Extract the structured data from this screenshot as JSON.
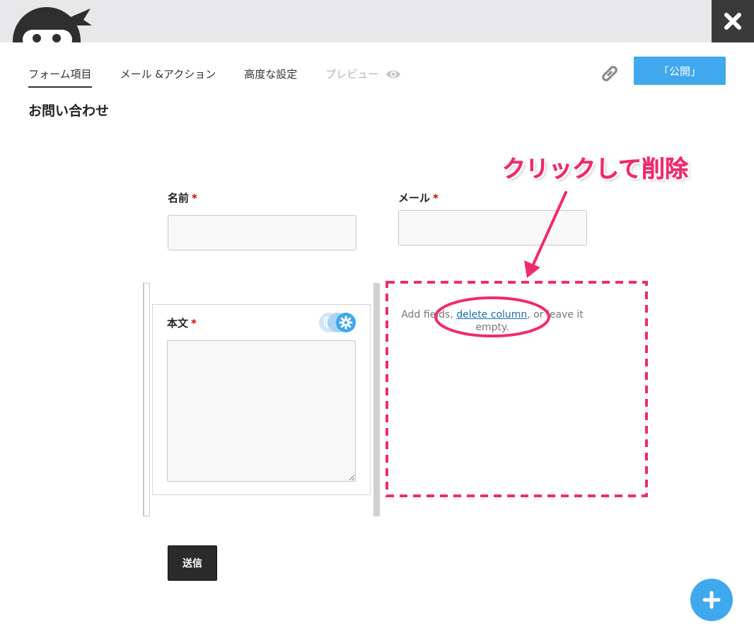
{
  "tabs": [
    {
      "label": "フォーム項目"
    },
    {
      "label": "メール &アクション"
    },
    {
      "label": "高度な設定"
    },
    {
      "label": "プレビュー"
    }
  ],
  "header": {
    "publish_label": "「公開」"
  },
  "form": {
    "title": "お問い合わせ",
    "fields": {
      "name_label": "名前",
      "email_label": "メール",
      "body_label": "本文",
      "required_mark": "*"
    },
    "empty_column": {
      "text_before": "Add fields, ",
      "link": "delete column",
      "text_after": ", or leave it empty."
    },
    "submit_label": "送信"
  },
  "annotation": {
    "text": "クリックして削除",
    "color": "#ef2b6f"
  },
  "colors": {
    "accent": "#40a8ec",
    "dark": "#2b2b2b",
    "required": "#d40000"
  },
  "icons": {
    "close": "close-icon",
    "link": "link-icon",
    "eye": "eye-icon",
    "gear": "gear-icon",
    "duplicate": "duplicate-icon",
    "plus": "plus-icon",
    "logo": "ninja-logo"
  }
}
